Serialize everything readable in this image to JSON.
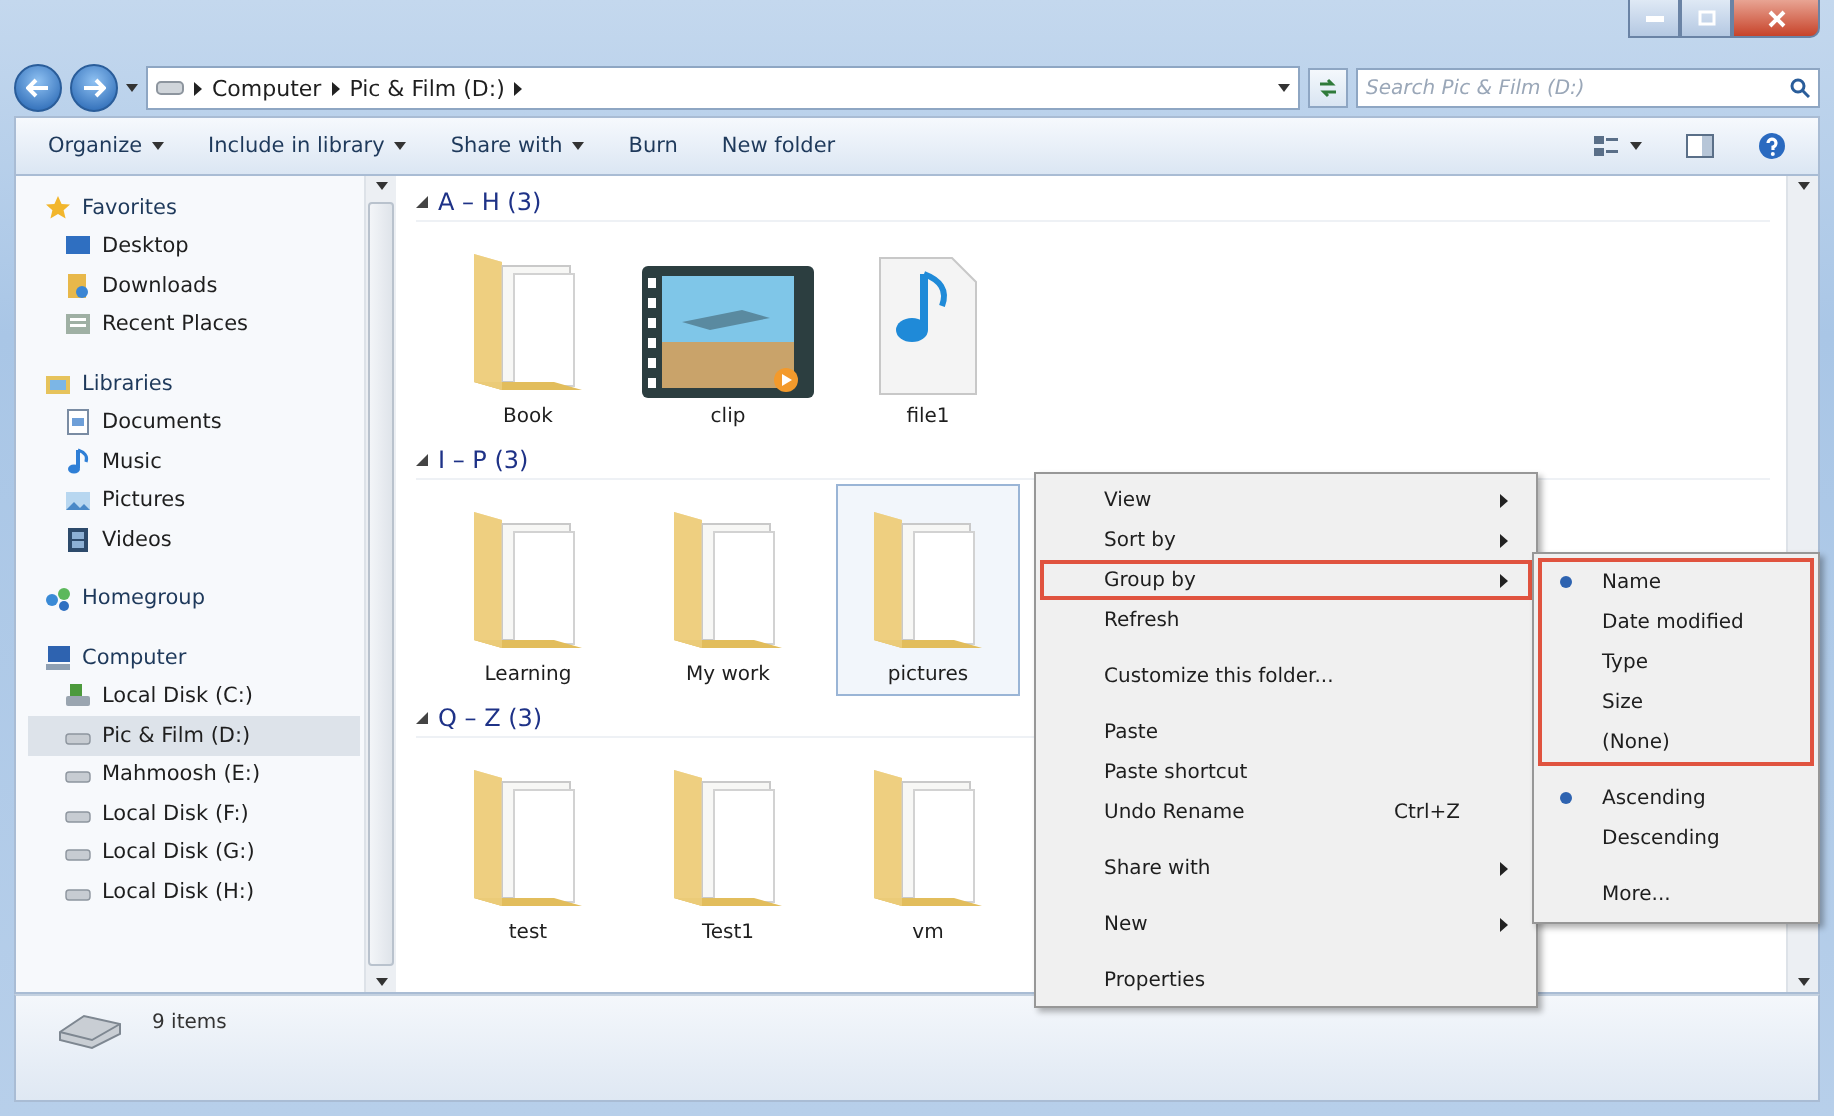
{
  "address": {
    "crumbs": [
      "Computer",
      "Pic & Film (D:)"
    ]
  },
  "search": {
    "placeholder": "Search Pic & Film (D:)"
  },
  "toolbar": [
    {
      "label": "Organize",
      "has_menu": true
    },
    {
      "label": "Include in library",
      "has_menu": true
    },
    {
      "label": "Share with",
      "has_menu": true
    },
    {
      "label": "Burn",
      "has_menu": false
    },
    {
      "label": "New folder",
      "has_menu": false
    }
  ],
  "sidebar": {
    "sections": [
      {
        "label": "Favorites",
        "kind": "favorites",
        "selected": false,
        "children": [
          {
            "label": "Desktop",
            "kind": "desktop",
            "selected": false
          },
          {
            "label": "Downloads",
            "kind": "downloads",
            "selected": false
          },
          {
            "label": "Recent Places",
            "kind": "recent",
            "selected": false
          }
        ]
      },
      {
        "label": "Libraries",
        "kind": "libraries",
        "selected": false,
        "children": [
          {
            "label": "Documents",
            "kind": "documents",
            "selected": false
          },
          {
            "label": "Music",
            "kind": "music",
            "selected": false
          },
          {
            "label": "Pictures",
            "kind": "pictures",
            "selected": false
          },
          {
            "label": "Videos",
            "kind": "videos",
            "selected": false
          }
        ]
      },
      {
        "label": "Homegroup",
        "kind": "homegroup",
        "selected": false
      },
      {
        "label": "Computer",
        "kind": "computer",
        "selected": false,
        "children": [
          {
            "label": "Local Disk (C:)",
            "kind": "system-drive",
            "selected": false
          },
          {
            "label": "Pic & Film (D:)",
            "kind": "drive",
            "selected": true
          },
          {
            "label": "Mahmoosh (E:)",
            "kind": "drive",
            "selected": false
          },
          {
            "label": "Local Disk (F:)",
            "kind": "drive",
            "selected": false
          },
          {
            "label": "Local Disk (G:)",
            "kind": "drive",
            "selected": false
          },
          {
            "label": "Local Disk (H:)",
            "kind": "drive",
            "selected": false
          }
        ]
      }
    ]
  },
  "groups": [
    {
      "title": "A – H (3)",
      "items": [
        {
          "name": "Book",
          "kind": "folder",
          "selected": false
        },
        {
          "name": "clip",
          "kind": "video",
          "selected": false
        },
        {
          "name": "file1",
          "kind": "mp3",
          "selected": false
        }
      ]
    },
    {
      "title": "I – P (3)",
      "items": [
        {
          "name": "Learning",
          "kind": "folder",
          "selected": false
        },
        {
          "name": "My work",
          "kind": "folder",
          "selected": false
        },
        {
          "name": "pictures",
          "kind": "folder",
          "selected": true
        }
      ]
    },
    {
      "title": "Q – Z (3)",
      "items": [
        {
          "name": "test",
          "kind": "folder",
          "selected": false
        },
        {
          "name": "Test1",
          "kind": "folder",
          "selected": false
        },
        {
          "name": "vm",
          "kind": "folder",
          "selected": false
        }
      ]
    }
  ],
  "context_menu": [
    {
      "kind": "item",
      "label": "View",
      "has_submenu": true,
      "highlighted": false
    },
    {
      "kind": "item",
      "label": "Sort by",
      "has_submenu": true,
      "highlighted": false
    },
    {
      "kind": "item",
      "label": "Group by",
      "has_submenu": true,
      "highlighted": true
    },
    {
      "kind": "item",
      "label": "Refresh",
      "has_submenu": false,
      "highlighted": false
    },
    {
      "kind": "separator"
    },
    {
      "kind": "item",
      "label": "Customize this folder...",
      "has_submenu": false,
      "highlighted": false
    },
    {
      "kind": "separator"
    },
    {
      "kind": "item",
      "label": "Paste",
      "has_submenu": false,
      "highlighted": false
    },
    {
      "kind": "item",
      "label": "Paste shortcut",
      "has_submenu": false,
      "highlighted": false
    },
    {
      "kind": "item",
      "label": "Undo Rename",
      "shortcut": "Ctrl+Z",
      "has_submenu": false,
      "highlighted": false
    },
    {
      "kind": "separator"
    },
    {
      "kind": "item",
      "label": "Share with",
      "has_submenu": true,
      "highlighted": false
    },
    {
      "kind": "separator"
    },
    {
      "kind": "item",
      "label": "New",
      "has_submenu": true,
      "highlighted": false
    },
    {
      "kind": "separator"
    },
    {
      "kind": "item",
      "label": "Properties",
      "has_submenu": false,
      "highlighted": false
    }
  ],
  "submenu": {
    "sections": [
      {
        "highlighted": true,
        "items": [
          {
            "label": "Name",
            "selected": true
          },
          {
            "label": "Date modified",
            "selected": false
          },
          {
            "label": "Type",
            "selected": false
          },
          {
            "label": "Size",
            "selected": false
          },
          {
            "label": "(None)",
            "selected": false
          }
        ]
      },
      {
        "highlighted": false,
        "items": [
          {
            "label": "Ascending",
            "selected": true
          },
          {
            "label": "Descending",
            "selected": false
          }
        ]
      },
      {
        "highlighted": false,
        "items": [
          {
            "label": "More...",
            "selected": false
          }
        ]
      }
    ]
  },
  "status": {
    "text": "9 items"
  }
}
